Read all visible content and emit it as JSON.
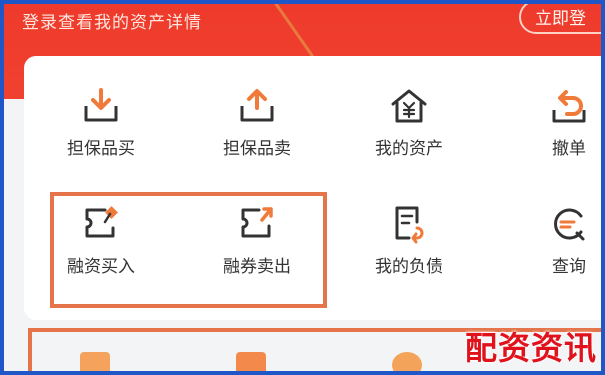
{
  "header": {
    "prompt_text": "登录查看我的资产详情",
    "login_button": "立即登"
  },
  "menu": {
    "row1": [
      {
        "label": "担保品买",
        "icon": "download-tray-icon"
      },
      {
        "label": "担保品卖",
        "icon": "upload-tray-icon"
      },
      {
        "label": "我的资产",
        "icon": "house-yen-icon"
      },
      {
        "label": "撤单",
        "icon": "undo-arrow-icon"
      }
    ],
    "row2": [
      {
        "label": "融资买入",
        "icon": "ticket-buy-icon"
      },
      {
        "label": "融券卖出",
        "icon": "ticket-sell-icon"
      },
      {
        "label": "我的负债",
        "icon": "document-return-icon"
      },
      {
        "label": "查询",
        "icon": "search-refresh-icon"
      }
    ]
  },
  "watermark": "配资资讯",
  "colors": {
    "header_red": "#ee3a2c",
    "accent_orange": "#f07a3a",
    "highlight_border": "#e5744a",
    "border_blue": "#1f57c9",
    "watermark_red": "#e0121c"
  }
}
